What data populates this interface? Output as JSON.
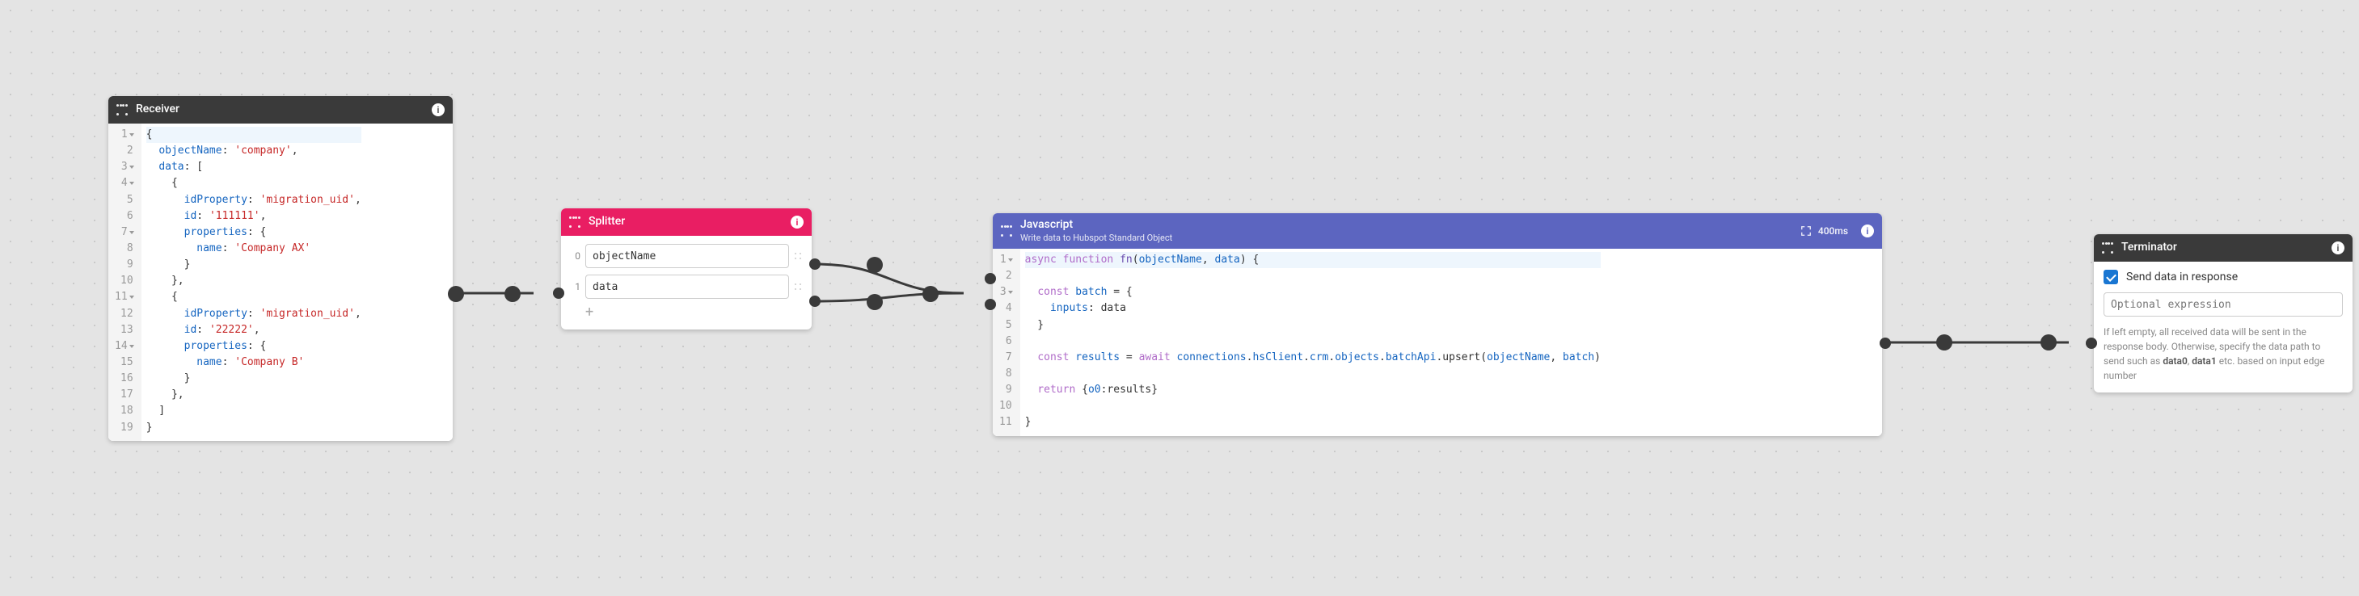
{
  "nodes": {
    "receiver": {
      "title": "Receiver",
      "code_lines": [
        "{",
        "  objectName: 'company',",
        "  data: [",
        "    {",
        "      idProperty: 'migration_uid',",
        "      id: '111111',",
        "      properties: {",
        "        name: 'Company AX'",
        "      }",
        "    },",
        "    {",
        "      idProperty: 'migration_uid',",
        "      id: '22222',",
        "      properties: {",
        "        name: 'Company B'",
        "      }",
        "    },",
        "  ]",
        "}"
      ]
    },
    "splitter": {
      "title": "Splitter",
      "rows": [
        {
          "idx": "0",
          "value": "objectName"
        },
        {
          "idx": "1",
          "value": "data"
        }
      ],
      "add_label": "+"
    },
    "javascript": {
      "title": "Javascript",
      "subtitle": "Write data to Hubspot Standard Object",
      "badge": "400ms",
      "code_lines": [
        "async function fn(objectName, data) {",
        "",
        "  const batch = {",
        "    inputs: data",
        "  }",
        "",
        "  const results = await connections.hsClient.crm.objects.batchApi.upsert(objectName, batch)",
        "",
        "  return {o0:results}",
        "",
        "}"
      ]
    },
    "terminator": {
      "title": "Terminator",
      "checkbox_label": "Send data in response",
      "checkbox_checked": true,
      "input_placeholder": "Optional expression",
      "help_pre": "If left empty, all received data will be sent in the response body. Otherwise, specify the data path to send such as ",
      "help_b1": "data0",
      "help_mid": ", ",
      "help_b2": "data1",
      "help_post": " etc. based on input edge number"
    }
  },
  "info_glyph": "i"
}
